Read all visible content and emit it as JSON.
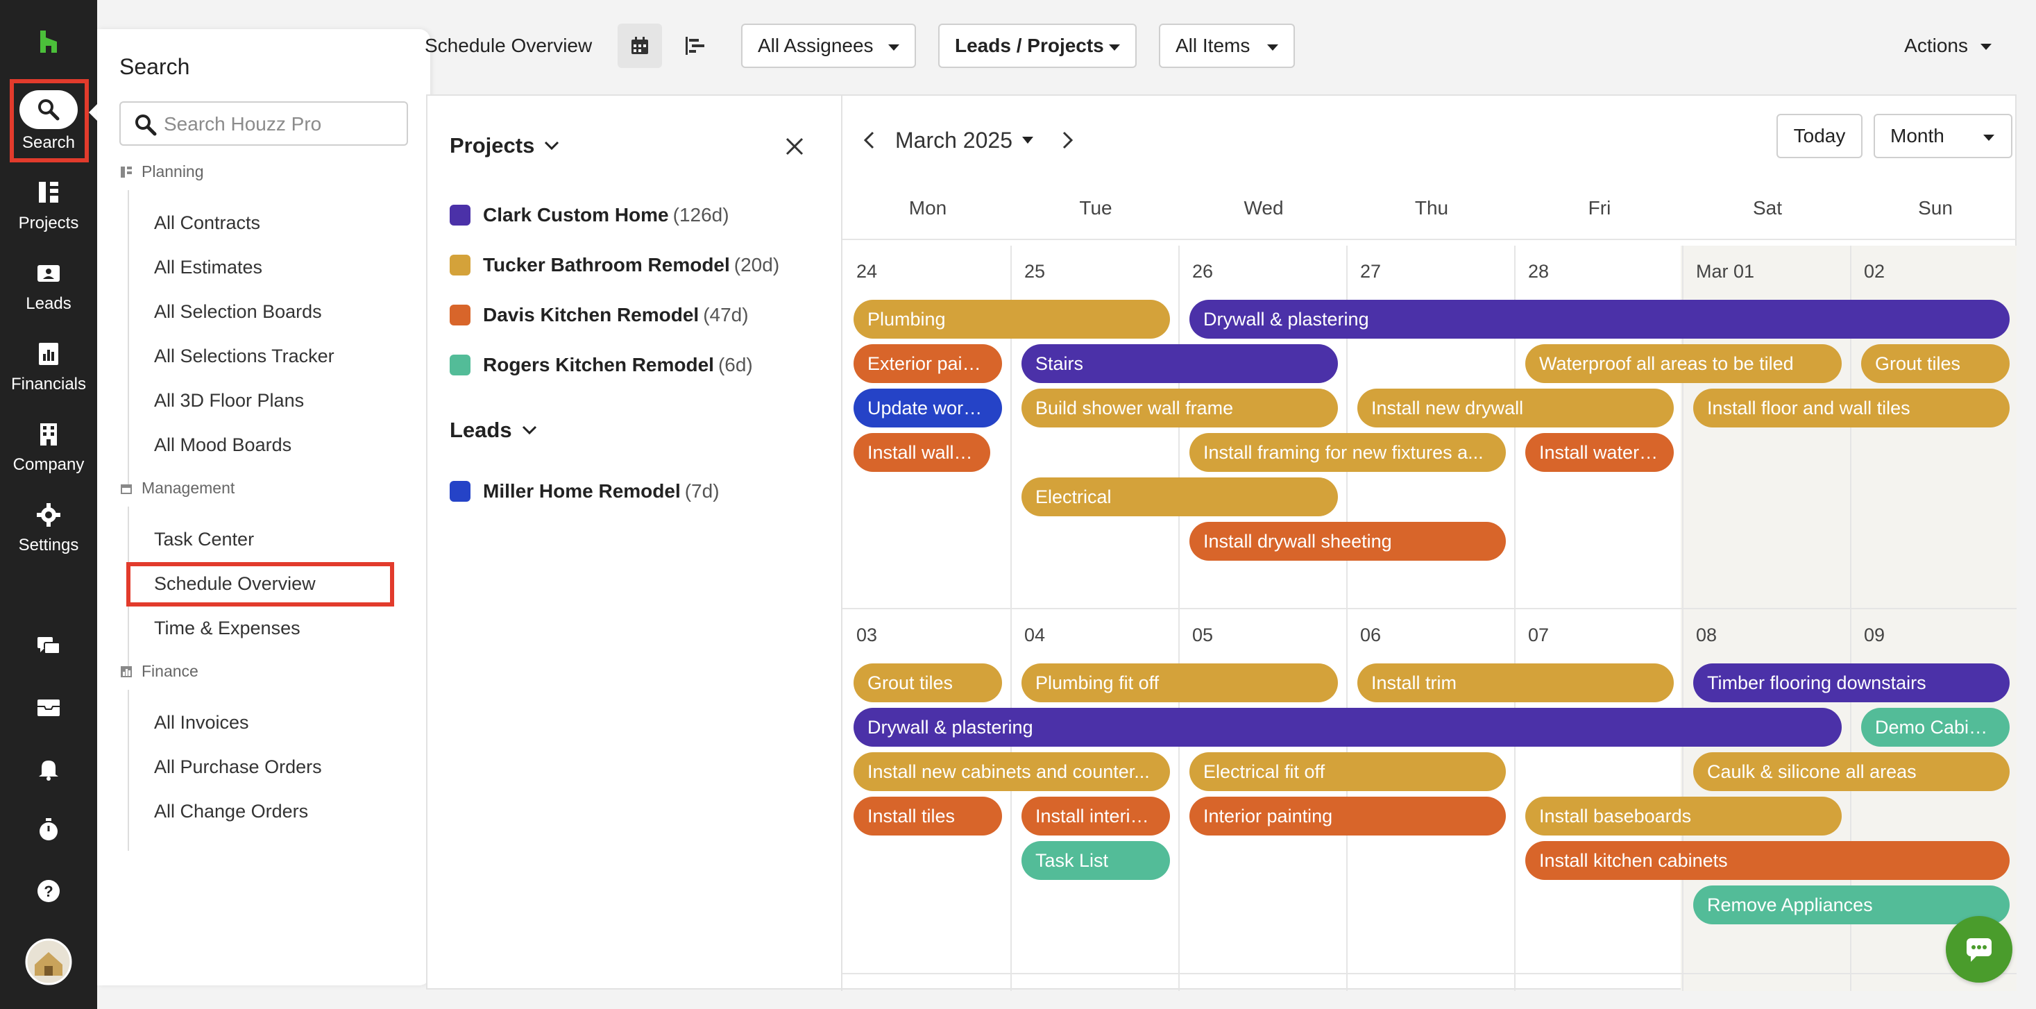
{
  "sidebar": {
    "items": [
      {
        "label": "Search",
        "icon": "search-icon"
      },
      {
        "label": "Projects",
        "icon": "projects-icon"
      },
      {
        "label": "Leads",
        "icon": "leads-icon"
      },
      {
        "label": "Financials",
        "icon": "financials-icon"
      },
      {
        "label": "Company",
        "icon": "company-icon"
      },
      {
        "label": "Settings",
        "icon": "gear-icon"
      }
    ]
  },
  "flyout": {
    "title": "Search",
    "search_placeholder": "Search Houzz Pro",
    "sections": [
      {
        "heading": "Planning",
        "items": [
          "All Contracts",
          "All Estimates",
          "All Selection Boards",
          "All Selections Tracker",
          "All 3D Floor Plans",
          "All Mood Boards"
        ]
      },
      {
        "heading": "Management",
        "items": [
          "Task Center",
          "Schedule Overview",
          "Time & Expenses"
        ]
      },
      {
        "heading": "Finance",
        "items": [
          "All Invoices",
          "All Purchase Orders",
          "All Change Orders"
        ]
      }
    ]
  },
  "topbar": {
    "title": "Schedule Overview",
    "filters": [
      "All Assignees",
      "Leads / Projects",
      "All Items"
    ],
    "actions": "Actions"
  },
  "panel": {
    "projects_heading": "Projects",
    "projects": [
      {
        "name": "Clark Custom Home",
        "duration": "(126d)",
        "color": "#4b31a8"
      },
      {
        "name": "Tucker Bathroom Remodel",
        "duration": "(20d)",
        "color": "#d4a23a"
      },
      {
        "name": "Davis Kitchen Remodel",
        "duration": "(47d)",
        "color": "#d8652a"
      },
      {
        "name": "Rogers Kitchen Remodel",
        "duration": "(6d)",
        "color": "#53bc98"
      }
    ],
    "leads_heading": "Leads",
    "leads": [
      {
        "name": "Miller Home Remodel",
        "duration": "(7d)",
        "color": "#2543c7"
      }
    ]
  },
  "calendar": {
    "month_label": "March 2025",
    "today_label": "Today",
    "view_label": "Month",
    "weekdays": [
      "Mon",
      "Tue",
      "Wed",
      "Thu",
      "Fri",
      "Sat",
      "Sun"
    ],
    "week1_days": [
      "24",
      "25",
      "26",
      "27",
      "28",
      "Mar 01",
      "02"
    ],
    "week2_days": [
      "03",
      "04",
      "05",
      "06",
      "07",
      "08",
      "09"
    ],
    "week1_events": [
      {
        "label": "Plumbing",
        "color": "#d4a23a"
      },
      {
        "label": "Drywall & plastering",
        "color": "#4b31a8"
      },
      {
        "label": "Exterior paint...",
        "color": "#d8652a"
      },
      {
        "label": "Stairs",
        "color": "#4b31a8"
      },
      {
        "label": "Waterproof all areas to be tiled",
        "color": "#d4a23a"
      },
      {
        "label": "Grout tiles",
        "color": "#d4a23a"
      },
      {
        "label": "Update work ...",
        "color": "#2543c7"
      },
      {
        "label": "Build shower wall frame",
        "color": "#d4a23a"
      },
      {
        "label": "Install new drywall",
        "color": "#d4a23a"
      },
      {
        "label": "Install floor and wall tiles",
        "color": "#d4a23a"
      },
      {
        "label": "Install wall an...",
        "color": "#d8652a"
      },
      {
        "label": "Install framing for new fixtures a...",
        "color": "#d4a23a"
      },
      {
        "label": "Install waterp...",
        "color": "#d8652a"
      },
      {
        "label": "Electrical",
        "color": "#d4a23a"
      },
      {
        "label": "Install drywall sheeting",
        "color": "#d8652a"
      }
    ],
    "week2_events": [
      {
        "label": "Grout tiles",
        "color": "#d4a23a"
      },
      {
        "label": "Plumbing fit off",
        "color": "#d4a23a"
      },
      {
        "label": "Install trim",
        "color": "#d4a23a"
      },
      {
        "label": "Timber flooring downstairs",
        "color": "#4b31a8"
      },
      {
        "label": "Drywall & plastering",
        "color": "#4b31a8"
      },
      {
        "label": "Demo Cabine...",
        "color": "#53bc98"
      },
      {
        "label": "Install new cabinets and counter...",
        "color": "#d4a23a"
      },
      {
        "label": "Electrical fit off",
        "color": "#d4a23a"
      },
      {
        "label": "Caulk & silicone all areas",
        "color": "#d4a23a"
      },
      {
        "label": "Install tiles",
        "color": "#d8652a"
      },
      {
        "label": "Install interio...",
        "color": "#d8652a"
      },
      {
        "label": "Interior painting",
        "color": "#d8652a"
      },
      {
        "label": "Install baseboards",
        "color": "#d4a23a"
      },
      {
        "label": "Task List",
        "color": "#53bc98"
      },
      {
        "label": "Install kitchen cabinets",
        "color": "#d8652a"
      },
      {
        "label": "Remove Appliances",
        "color": "#53bc98"
      }
    ]
  }
}
